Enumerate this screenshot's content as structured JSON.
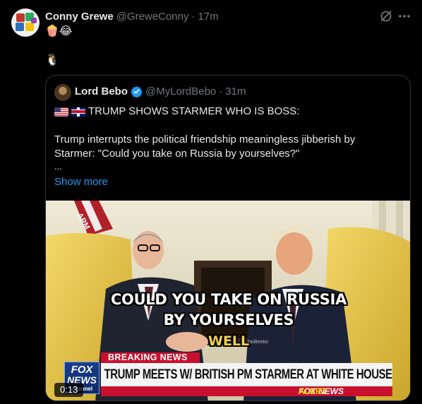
{
  "post": {
    "author_name": "Conny Grewe",
    "author_handle": "@GreweConny",
    "separator": "·",
    "time": "17m",
    "text_line1": "🍿😂",
    "text_line2": "🐧",
    "more_icon": "more-horizontal-icon",
    "grok_icon": "grok-icon"
  },
  "quote": {
    "author_name": "Lord Bebo",
    "author_handle": "@MyLordBebo",
    "separator": "·",
    "time": "31m",
    "headline": "TRUMP SHOWS STARMER WHO IS BOSS:",
    "body_line1": "Trump interrupts the political friendship meaningless jibberish by",
    "body_line2": "Starmer: \"Could you take on Russia by yourselves?\"",
    "ellipsis": "...",
    "show_more": "Show more",
    "verified_color": "#1d9bf0"
  },
  "video": {
    "caption_line1": "COULD YOU TAKE ON RUSSIA",
    "caption_line2": "BY YOURSELVES",
    "caption_word": "WELL",
    "watermark": "NoBeebo",
    "breaking_label": "BREAKING NEWS",
    "headline": "TRUMP MEETS W/ BRITISH PM STARMER AT WHITE HOUSE",
    "network_label": "FOX NEWS",
    "alert_label": "ALERT",
    "logo_line1": "FOX",
    "logo_line2": "NEWS",
    "logo_line3": "channel",
    "duration": "0:13",
    "flag_text": "ARM"
  }
}
